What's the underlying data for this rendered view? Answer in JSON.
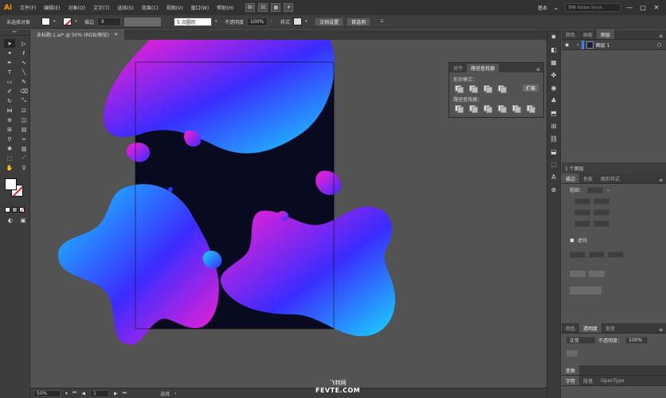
{
  "menubar": {
    "logo": "Ai",
    "items": [
      "文件(F)",
      "编辑(E)",
      "对象(O)",
      "文字(T)",
      "选择(S)",
      "效果(C)",
      "视图(V)",
      "窗口(W)",
      "帮助(H)"
    ],
    "icon_labels": [
      "Br",
      "St"
    ],
    "workspace": "基本",
    "search_placeholder": "搜索 Adobe Stock",
    "window_buttons": [
      "—",
      "□",
      "✕"
    ]
  },
  "controlbar": {
    "selection_label": "未选择对象",
    "stroke_label": "描边",
    "brush_value": "5 点圆形",
    "opacity_label": "不透明度",
    "opacity_value": "100%",
    "style_label": "样式",
    "doc_setup": "文档设置",
    "preferences": "首选项"
  },
  "document": {
    "tab_title": "未标题-1.ai* @ 50% (RGB/预览)",
    "close": "✕"
  },
  "tools": [
    {
      "name": "selection-tool",
      "glyph": "➤"
    },
    {
      "name": "direct-selection-tool",
      "glyph": "▷"
    },
    {
      "name": "magic-wand-tool",
      "glyph": "✦"
    },
    {
      "name": "lasso-tool",
      "glyph": "ℓ"
    },
    {
      "name": "pen-tool",
      "glyph": "✒"
    },
    {
      "name": "curvature-tool",
      "glyph": "∿"
    },
    {
      "name": "type-tool",
      "glyph": "T"
    },
    {
      "name": "line-tool",
      "glyph": "╲"
    },
    {
      "name": "rectangle-tool",
      "glyph": "▭"
    },
    {
      "name": "paintbrush-tool",
      "glyph": "✎"
    },
    {
      "name": "shaper-tool",
      "glyph": "✐"
    },
    {
      "name": "eraser-tool",
      "glyph": "⌫"
    },
    {
      "name": "rotate-tool",
      "glyph": "↻"
    },
    {
      "name": "scale-tool",
      "glyph": "⤡"
    },
    {
      "name": "width-tool",
      "glyph": "⋈"
    },
    {
      "name": "free-transform-tool",
      "glyph": "⊡"
    },
    {
      "name": "shape-builder-tool",
      "glyph": "⊕"
    },
    {
      "name": "perspective-tool",
      "glyph": "◫"
    },
    {
      "name": "mesh-tool",
      "glyph": "⊞"
    },
    {
      "name": "gradient-tool",
      "glyph": "▤"
    },
    {
      "name": "eyedropper-tool",
      "glyph": "⚲"
    },
    {
      "name": "blend-tool",
      "glyph": "∞"
    },
    {
      "name": "symbol-sprayer-tool",
      "glyph": "✺"
    },
    {
      "name": "column-graph-tool",
      "glyph": "▥"
    },
    {
      "name": "artboard-tool",
      "glyph": "⬚"
    },
    {
      "name": "slice-tool",
      "glyph": "⟋"
    },
    {
      "name": "hand-tool",
      "glyph": "✋"
    },
    {
      "name": "zoom-tool",
      "glyph": "⚲"
    }
  ],
  "canvas": {
    "colors": {
      "artboard": "#080a1f",
      "pink": "#ff1fd0",
      "blue": "#3a2cff",
      "cyan": "#19d6ff"
    }
  },
  "pathfinder_panel": {
    "tabs": [
      "对齐",
      "路径查找器"
    ],
    "active_tab": 1,
    "shape_modes_label": "形状模式：",
    "expand_button": "扩展",
    "pathfinders_label": "路径查找器："
  },
  "layers_panel": {
    "tabs": [
      "颜色",
      "画板",
      "图层"
    ],
    "active_tab": 2,
    "layer_name": "图层 1",
    "footer": "1 个图层"
  },
  "stroke_panel": {
    "tabs": [
      "描边",
      "色板",
      "图形样式"
    ],
    "active_tab": 0,
    "weight_label": "粗细：",
    "dashed_label": "虚线"
  },
  "transparency_panel": {
    "tabs": [
      "颜色",
      "透明度",
      "渐变"
    ],
    "active_tab": 1,
    "blend_mode": "正常",
    "opacity_label": "不透明度：",
    "opacity_value": "100%"
  },
  "bottom_tabs": [
    "变换",
    "字符",
    "段落",
    "OpenType"
  ],
  "statusbar": {
    "zoom": "50%",
    "artboard_num": "1",
    "mode": "选择"
  },
  "watermark": {
    "line1": "飞特网",
    "line2": "FEVTE.COM"
  }
}
